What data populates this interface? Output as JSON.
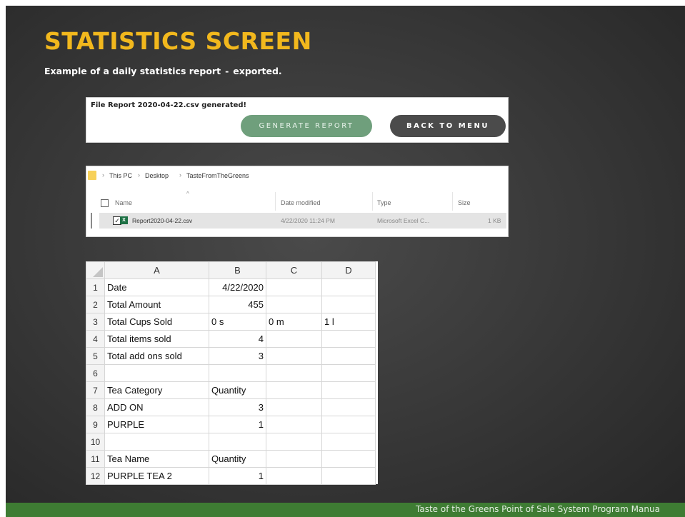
{
  "slide": {
    "title": "STATISTICS SCREEN",
    "subtitle_main": "Example of a daily statistics report",
    "subtitle_sep": "-",
    "subtitle_tail": "exported.",
    "footer": "Taste of the Greens Point of Sale System Program Manua"
  },
  "report_panel": {
    "message": "File Report 2020-04-22.csv generated!",
    "generate_label": "GENERATE REPORT",
    "back_label": "BACK TO MENU"
  },
  "explorer": {
    "breadcrumb": [
      "This PC",
      "Desktop",
      "TasteFromTheGreens"
    ],
    "columns": {
      "name": "Name",
      "date": "Date modified",
      "type": "Type",
      "size": "Size"
    },
    "file": {
      "name": "Report2020-04-22.csv",
      "date": "4/22/2020 11:24 PM",
      "type": "Microsoft Excel C...",
      "size": "1 KB"
    }
  },
  "spreadsheet": {
    "columns": [
      "A",
      "B",
      "C",
      "D"
    ],
    "rows": [
      {
        "n": "1",
        "a": "Date",
        "b": "4/22/2020",
        "c": "",
        "d": ""
      },
      {
        "n": "2",
        "a": "Total Amount",
        "b": "455",
        "c": "",
        "d": ""
      },
      {
        "n": "3",
        "a": "Total Cups Sold",
        "b": "0 s",
        "c": "0 m",
        "d": "1 l"
      },
      {
        "n": "4",
        "a": "Total items sold",
        "b": "4",
        "c": "",
        "d": ""
      },
      {
        "n": "5",
        "a": "Total add ons sold",
        "b": "3",
        "c": "",
        "d": ""
      },
      {
        "n": "6",
        "a": "",
        "b": "",
        "c": "",
        "d": ""
      },
      {
        "n": "7",
        "a": "Tea Category",
        "b": "Quantity",
        "c": "",
        "d": ""
      },
      {
        "n": "8",
        "a": "ADD ON",
        "b": "3",
        "c": "",
        "d": ""
      },
      {
        "n": "9",
        "a": "PURPLE",
        "b": "1",
        "c": "",
        "d": ""
      },
      {
        "n": "10",
        "a": "",
        "b": "",
        "c": "",
        "d": ""
      },
      {
        "n": "11",
        "a": "Tea Name",
        "b": "Quantity",
        "c": "",
        "d": ""
      },
      {
        "n": "12",
        "a": "PURPLE TEA 2",
        "b": "1",
        "c": "",
        "d": ""
      }
    ]
  },
  "colors": {
    "title": "#f2b81d",
    "generate_button": "#6f9f7c",
    "back_button": "#4b4b4b",
    "footer": "#3e7c33"
  },
  "icons": {
    "folder": "folder-icon",
    "excel": "excel-file-icon",
    "checkbox": "checkbox-icon",
    "chevron": "chevron-right-icon",
    "sort": "sort-up-icon"
  }
}
